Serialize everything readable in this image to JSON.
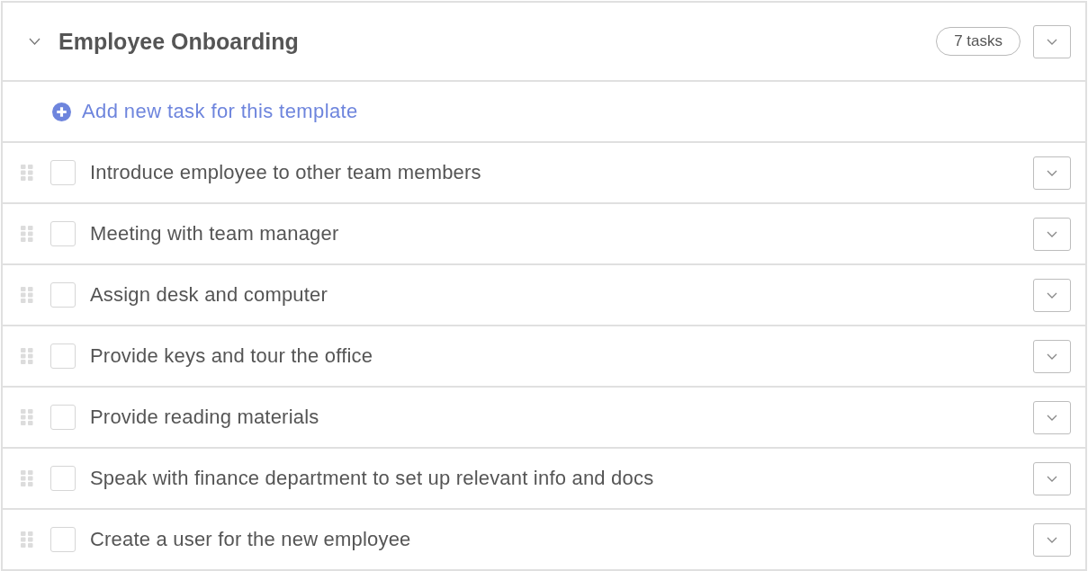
{
  "template": {
    "title": "Employee Onboarding",
    "expanded": true,
    "task_count": "7 tasks"
  },
  "add_task": {
    "label": "Add new task for this template"
  },
  "tasks": [
    {
      "label": "Introduce employee to other team members",
      "checked": false
    },
    {
      "label": "Meeting with team manager",
      "checked": false
    },
    {
      "label": "Assign desk and computer",
      "checked": false
    },
    {
      "label": "Provide keys and tour the office",
      "checked": false
    },
    {
      "label": "Provide reading materials",
      "checked": false
    },
    {
      "label": "Speak with finance department to set up relevant info and docs",
      "checked": false
    },
    {
      "label": "Create a user for the new employee",
      "checked": false
    }
  ]
}
